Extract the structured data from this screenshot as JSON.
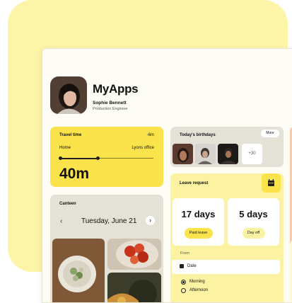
{
  "header": {
    "app_title": "MyApps",
    "user_name": "Sophie Bennett",
    "user_role": "Production Engineer"
  },
  "travel": {
    "title": "Travel time",
    "delta": "-6m",
    "from": "Home",
    "to": "Lyons office",
    "duration": "40m",
    "progress": 0.41
  },
  "canteen": {
    "title": "Canteen",
    "prev_icon": "‹",
    "date": "Tuesday, June 21",
    "next_icon": "›"
  },
  "birthdays": {
    "title": "Today's birthdays",
    "more_label": "More",
    "extra_count": "+30"
  },
  "leave": {
    "title": "Leave request",
    "paid_days": "17 days",
    "paid_label": "Paid leave",
    "off_days": "5 days",
    "off_label": "Day off",
    "from_label": "From",
    "date_placeholder": "Date",
    "options": [
      "Morning",
      "Afternoon"
    ],
    "selected_option": "Morning"
  },
  "colors": {
    "accent_yellow": "#fbe34b",
    "pale_yellow": "#fcf3a2",
    "background_blob": "#fcf5a8",
    "card_grey": "#e4e2d7"
  }
}
